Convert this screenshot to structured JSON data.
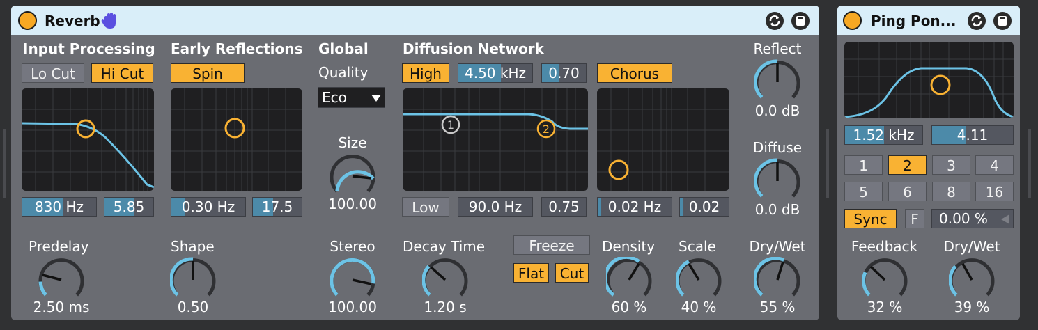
{
  "colors": {
    "accent": "#f9b233",
    "curve": "#6cc3e6",
    "title_bar": "#d9eef9",
    "panel": "#6a6c72"
  },
  "reverb": {
    "title": "Reverb",
    "hand_icon": "hand-icon",
    "input_processing": {
      "heading": "Input Processing",
      "lo_cut": "Lo Cut",
      "hi_cut": "Hi Cut",
      "freq": "830 Hz",
      "q": "5.85"
    },
    "early_reflections": {
      "heading": "Early Reflections",
      "spin": "Spin",
      "rate": "0.30 Hz",
      "amount": "17.5"
    },
    "global": {
      "heading": "Global",
      "quality_label": "Quality",
      "quality_value": "Eco",
      "size_label": "Size",
      "size_value": "100.00",
      "stereo_label": "Stereo",
      "stereo_value": "100.00"
    },
    "diffusion": {
      "heading": "Diffusion Network",
      "high": "High",
      "high_freq": "4.50 kHz",
      "high_amount": "0.70",
      "low": "Low",
      "low_freq": "90.0 Hz",
      "low_amount": "0.75",
      "chorus": "Chorus",
      "chorus_rate": "0.02 Hz",
      "chorus_amount": "0.02",
      "node1": "1",
      "node2": "2"
    },
    "predelay": {
      "label": "Predelay",
      "value": "2.50 ms"
    },
    "shape": {
      "label": "Shape",
      "value": "0.50"
    },
    "decay": {
      "label": "Decay Time",
      "value": "1.20 s"
    },
    "freeze": {
      "label": "Freeze",
      "flat": "Flat",
      "cut": "Cut"
    },
    "density": {
      "label": "Density",
      "value": "60 %"
    },
    "scale": {
      "label": "Scale",
      "value": "40 %"
    },
    "reflect": {
      "label": "Reflect",
      "value": "0.0 dB"
    },
    "diffuse": {
      "label": "Diffuse",
      "value": "0.0 dB"
    },
    "drywet": {
      "label": "Dry/Wet",
      "value": "55 %"
    }
  },
  "pingpong": {
    "title": "Ping Pon...",
    "freq": "1.52 kHz",
    "width": "4.11",
    "beats": [
      "1",
      "2",
      "3",
      "4",
      "5",
      "6",
      "8",
      "16"
    ],
    "selected_beat": "2",
    "sync": "Sync",
    "f_button": "F",
    "offset": "0.00 %",
    "feedback": {
      "label": "Feedback",
      "value": "32 %"
    },
    "drywet": {
      "label": "Dry/Wet",
      "value": "39 %"
    }
  }
}
